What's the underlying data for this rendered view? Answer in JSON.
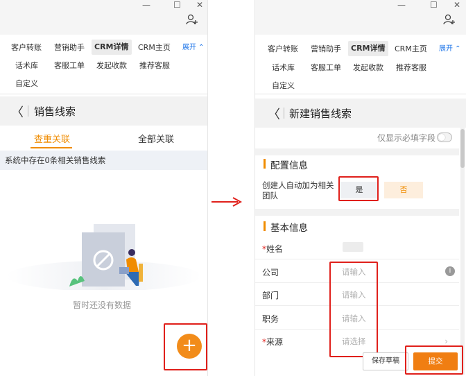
{
  "window": {
    "minimize_glyph": "—",
    "maximize_glyph": "☐",
    "close_glyph": "✕",
    "add_user_icon": "add-user-icon"
  },
  "nav_tabs": {
    "row1": [
      "客户转账",
      "营销助手",
      "CRM详情",
      "CRM主页"
    ],
    "expand_label": "展开 ⌃",
    "row2": [
      "话术库",
      "客服工单",
      "发起收款",
      "推荐客服"
    ],
    "row3": [
      "自定义"
    ],
    "active": "CRM详情"
  },
  "left": {
    "header_title": "销售线索",
    "back_glyph": "〈",
    "subtabs": [
      "查重关联",
      "全部关联"
    ],
    "info_text": "系统中存在0条相关销售线索",
    "empty_text": "暂时还没有数据",
    "fab_glyph": "+"
  },
  "right": {
    "header_title": "新建销售线索",
    "back_glyph": "〈",
    "toggle_label": "仅显示必填字段",
    "config_section": "配置信息",
    "config_field_label_line1": "创建人自动加为相关",
    "config_field_label_line2": "团队",
    "yes_label": "是",
    "no_label": "否",
    "basic_section": "基本信息",
    "fields": [
      {
        "label": "姓名",
        "required": true,
        "value": ""
      },
      {
        "label": "公司",
        "required": false,
        "value": "请输入"
      },
      {
        "label": "部门",
        "required": false,
        "value": "请输入"
      },
      {
        "label": "职务",
        "required": false,
        "value": "请输入"
      },
      {
        "label": "来源",
        "required": true,
        "value": "请选择"
      }
    ],
    "required_mark": "*",
    "save_draft_label": "保存草稿",
    "submit_label": "提交",
    "chevron_glyph": "›",
    "clear_glyph": "I"
  },
  "colors": {
    "accent_orange": "#f08c00",
    "highlight_red": "#e0201b",
    "link_blue": "#1a73e8"
  }
}
